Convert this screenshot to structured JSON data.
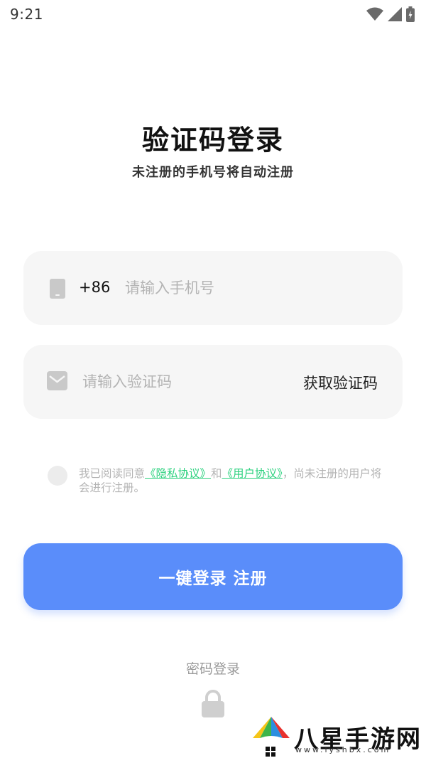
{
  "status_bar": {
    "time": "9:21"
  },
  "header": {
    "title": "验证码登录",
    "subtitle": "未注册的手机号将自动注册"
  },
  "phone_field": {
    "country_code": "+86",
    "value": "",
    "placeholder": "请输入手机号",
    "icon": "phone-icon"
  },
  "code_field": {
    "value": "",
    "placeholder": "请输入验证码",
    "icon": "mail-icon",
    "get_code_label": "获取验证码"
  },
  "agreement": {
    "checked": false,
    "prefix": "我已阅读同意",
    "privacy_link": "《隐私协议》",
    "connector": "和",
    "user_link": "《用户协议》",
    "suffix": "，尚未注册的用户将会进行注册。"
  },
  "login_button": {
    "label": "一键登录 注册"
  },
  "password_login": {
    "label": "密码登录",
    "icon": "lock-icon"
  },
  "watermark": {
    "text": "八星手游网",
    "url": "www.lyshbx.com"
  },
  "colors": {
    "primary": "#5a8dfa",
    "link": "#2bd17e",
    "field_bg": "#f6f6f6",
    "placeholder": "#b4b4b4"
  }
}
